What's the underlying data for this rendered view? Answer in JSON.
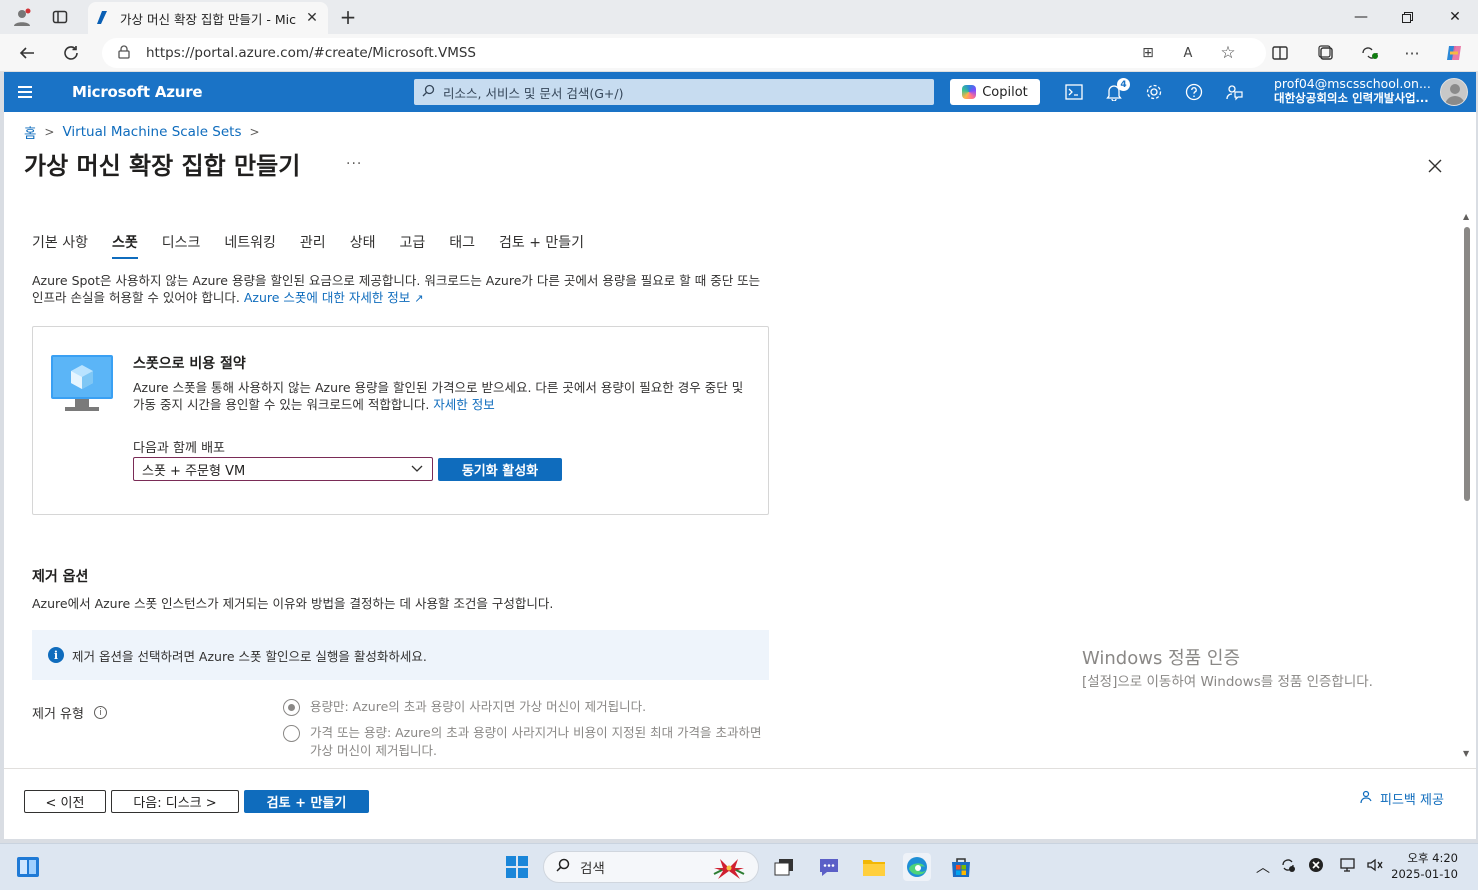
{
  "browser": {
    "tab_title": "가상 머신 확장 집합 만들기 - Mic",
    "url": "https://portal.azure.com/#create/Microsoft.VMSS"
  },
  "azure_header": {
    "brand": "Microsoft Azure",
    "search_placeholder": "리소스, 서비스 및 문서 검색(G+/)",
    "copilot_label": "Copilot",
    "notification_count": "4",
    "account_email": "prof04@mscsschool.on...",
    "account_org": "대한상공회의소 인력개발사업..."
  },
  "breadcrumb": {
    "items": [
      "홈",
      "Virtual Machine Scale Sets"
    ]
  },
  "page": {
    "title": "가상 머신 확장 집합 만들기",
    "more": "···"
  },
  "tabs": [
    {
      "label": "기본 사항",
      "active": false
    },
    {
      "label": "스폿",
      "active": true
    },
    {
      "label": "디스크",
      "active": false
    },
    {
      "label": "네트워킹",
      "active": false
    },
    {
      "label": "관리",
      "active": false
    },
    {
      "label": "상태",
      "active": false
    },
    {
      "label": "고급",
      "active": false
    },
    {
      "label": "태그",
      "active": false
    },
    {
      "label": "검토 + 만들기",
      "active": false
    }
  ],
  "spot_intro": {
    "text": "Azure Spot은 사용하지 않는 Azure 용량을 할인된 요금으로 제공합니다. 워크로드는 Azure가 다른 곳에서 용량을 필요로 할 때 중단 또는 인프라 손실을 허용할 수 있어야 합니다.",
    "link": "Azure 스폿에 대한 자세한 정보"
  },
  "spot_card": {
    "title": "스폿으로 비용 절약",
    "description": "Azure 스폿을 통해 사용하지 않는 Azure 용량을 할인된 가격으로 받으세요. 다른 곳에서 용량이 필요한 경우 중단 및 가동 중지 시간을 용인할 수 있는 워크로드에 적합합니다.",
    "link": "자세한 정보",
    "deploy_label": "다음과 함께 배포",
    "deploy_value": "스폿 + 주문형 VM",
    "enable_button": "동기화 활성화"
  },
  "eviction": {
    "title": "제거 옵션",
    "description": "Azure에서 Azure 스폿 인스턴스가 제거되는 이유와 방법을 결정하는 데 사용할 조건을 구성합니다.",
    "info": "제거 옵션을 선택하려면 Azure 스폿 할인으로 실행을 활성화하세요.",
    "type_label": "제거 유형",
    "options": [
      {
        "label": "용량만: Azure의 초과 용량이 사라지면 가상 머신이 제거됩니다.",
        "checked": true
      },
      {
        "label": "가격 또는 용량: Azure의 초과 용량이 사라지거나 비용이 지정된 최대 가격을 초과하면 가상 머신이 제거됩니다.",
        "checked": false
      }
    ]
  },
  "footer": {
    "prev": "< 이전",
    "next": "다음: 디스크 >",
    "review": "검토 + 만들기",
    "feedback": "피드백 제공"
  },
  "watermark": {
    "line1": "Windows 정품 인증",
    "line2": "[설정]으로 이동하여 Windows를 정품 인증합니다."
  },
  "taskbar": {
    "search": "검색",
    "time": "오후 4:20",
    "date": "2025-01-10"
  },
  "colors": {
    "azure_blue": "#1a73c6",
    "primary": "#0f6cbd"
  }
}
